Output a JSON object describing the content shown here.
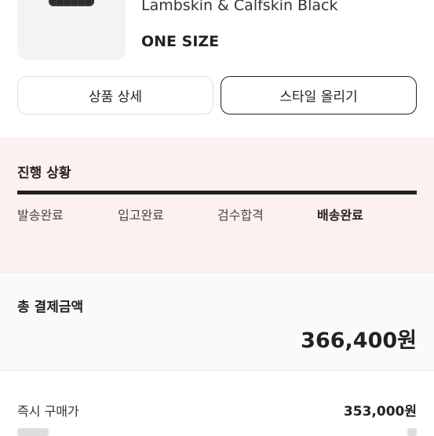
{
  "product": {
    "name": "Lambskin & Calfskin Black",
    "size": "ONE SIZE"
  },
  "actions": {
    "detail_label": "상품 상세",
    "style_label": "스타일 올리기"
  },
  "progress": {
    "title": "진행 상황",
    "steps": [
      {
        "label": "발송완료"
      },
      {
        "label": "입고완료"
      },
      {
        "label": "검수합격"
      },
      {
        "label": "배송완료"
      }
    ]
  },
  "payment": {
    "total_label": "총 결제금액",
    "total_amount": "366,400원",
    "instant_buy_label": "즉시 구매가",
    "instant_buy_amount": "353,000원"
  }
}
